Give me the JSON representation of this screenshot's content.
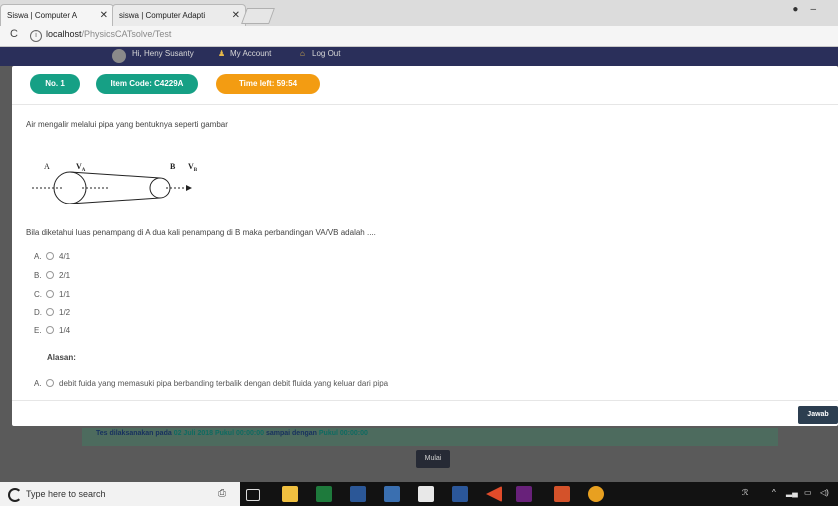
{
  "browser": {
    "tabs": [
      {
        "label": "Siswa | Computer A"
      },
      {
        "label": "siswa | Computer Adapti"
      }
    ],
    "url_host": "localhost",
    "url_path": "/PhysicsCATsolve/Test"
  },
  "nav": {
    "greeting": "Hi, Heny Susanty",
    "account": "My Account",
    "logout": "Log Out"
  },
  "modal": {
    "number": "No. 1",
    "item_code": "Item Code: C4229A",
    "time_left": "Time left: 59:54",
    "question": "Air mengalir melalui pipa yang bentuknya seperti gambar",
    "question2": "Bila diketahui luas penampang di A dua kali penampang di B maka perbandingan VA/VB adalah ....",
    "diagram": {
      "label_a": "A",
      "label_va": "V",
      "sub_a": "A",
      "label_b": "B",
      "label_vb": "V",
      "sub_b": "B"
    },
    "options": [
      {
        "letter": "A.",
        "text": "4/1"
      },
      {
        "letter": "B.",
        "text": "2/1"
      },
      {
        "letter": "C.",
        "text": "1/1"
      },
      {
        "letter": "D.",
        "text": "1/2"
      },
      {
        "letter": "E.",
        "text": "1/4"
      }
    ],
    "reason_heading": "Alasan:",
    "reason_option": {
      "letter": "A.",
      "text": "debit fuida yang memasuki pipa berbanding terbalik dengan debit fluida yang keluar dari pipa"
    },
    "submit": "Jawab"
  },
  "page": {
    "info_prefix": "Tes dilaksanakan pada",
    "info_date": "02 Juli 2018",
    "info_time1": "Pukul 00:00:00",
    "info_mid": "sampai dengan",
    "info_time2": "Pukul 00:00:00",
    "start_button": "Mulai"
  },
  "taskbar": {
    "search_placeholder": "Type here to search"
  }
}
